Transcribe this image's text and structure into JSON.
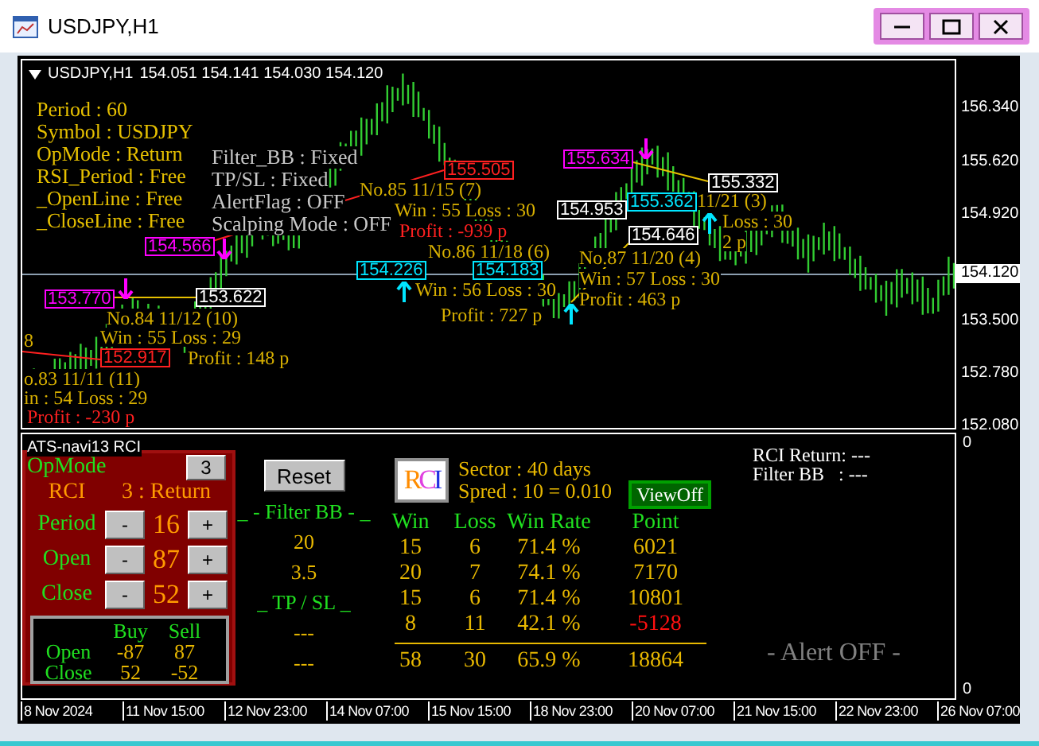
{
  "window": {
    "title": "USDJPY,H1"
  },
  "chart": {
    "header": {
      "symbol": "USDJPY,H1",
      "ohlc": "154.051 154.141 154.030 154.120"
    },
    "info_left": [
      "Period : 60",
      "Symbol : USDJPY",
      "OpMode : Return",
      "RSI_Period : Free",
      "_OpenLine : Free",
      "_CloseLine : Free"
    ],
    "info_right": [
      "Filter_BB : Fixed",
      "TP/SL : Fixed",
      "AlertFlag : OFF",
      "Scalping Mode : OFF"
    ],
    "trade_lines": [
      {
        "kind": "loss"
      },
      {
        "kind": "loss"
      },
      {
        "kind": "win"
      },
      {
        "kind": "win"
      },
      {
        "kind": "win"
      }
    ],
    "trade_texts": [
      {
        "text": "No.84  11/12 (10)",
        "kind": "info"
      },
      {
        "text": "Win : 55   Loss : 29",
        "kind": "info"
      },
      {
        "text": "Profit : 148 p",
        "kind": "info"
      },
      {
        "text": "8",
        "kind": "info"
      },
      {
        "text": "o.83  11/11 (11)",
        "kind": "info"
      },
      {
        "text": "in : 54   Loss : 29",
        "kind": "info"
      },
      {
        "text": "Profit : -230 p",
        "kind": "loss"
      },
      {
        "text": "No.85  11/15 (7)",
        "kind": "info"
      },
      {
        "text": "Win : 55   Loss : 30",
        "kind": "info"
      },
      {
        "text": "Profit : -939 p",
        "kind": "loss"
      },
      {
        "text": "No.86  11/18 (6)",
        "kind": "info"
      },
      {
        "text": "Win : 56   Loss : 30",
        "kind": "info"
      },
      {
        "text": "Profit : 727 p",
        "kind": "info"
      },
      {
        "text": "No.87  11/20 (4)",
        "kind": "info"
      },
      {
        "text": "Win : 57   Loss : 30",
        "kind": "info"
      },
      {
        "text": "Profit : 463 p",
        "kind": "info"
      },
      {
        "text": "11/21 (3)",
        "kind": "info"
      },
      {
        "text": "Loss : 30",
        "kind": "info"
      },
      {
        "text": "2 p",
        "kind": "info"
      }
    ],
    "price_labels": [
      {
        "text": "154.566",
        "kind": "sell"
      },
      {
        "text": "153.770",
        "kind": "sell"
      },
      {
        "text": "153.622",
        "kind": "close"
      },
      {
        "text": "152.917",
        "kind": "loss"
      },
      {
        "text": "155.505",
        "kind": "loss"
      },
      {
        "text": "154.226",
        "kind": "buy"
      },
      {
        "text": "154.183",
        "kind": "buy"
      },
      {
        "text": "154.953",
        "kind": "close"
      },
      {
        "text": "155.634",
        "kind": "sell"
      },
      {
        "text": "155.332",
        "kind": "close"
      },
      {
        "text": "154.646",
        "kind": "close"
      },
      {
        "text": "155.362",
        "kind": "buy"
      }
    ],
    "arrows": [
      {
        "kind": "sell"
      },
      {
        "kind": "sell"
      },
      {
        "kind": "sell"
      },
      {
        "kind": "buy"
      },
      {
        "kind": "buy"
      },
      {
        "kind": "buy"
      }
    ],
    "current_price": "154.120",
    "price_axis": [
      "156.340",
      "155.620",
      "154.920",
      "153.500",
      "152.780",
      "152.080"
    ]
  },
  "indicator": {
    "title": "ATS-navi13  RCI",
    "opmode": {
      "label": "OpMode",
      "value": "3"
    },
    "mode": {
      "label": "RCI",
      "value": "3 : Return"
    },
    "steppers": [
      {
        "label": "Period",
        "minus": "-",
        "value": "16",
        "plus": "+"
      },
      {
        "label": "Open",
        "minus": "-",
        "value": "87",
        "plus": "+"
      },
      {
        "label": "Close",
        "minus": "-",
        "value": "52",
        "plus": "+"
      }
    ],
    "signal_table": {
      "columns": [
        "Buy",
        "Sell"
      ],
      "rows": [
        {
          "label": "Open",
          "buy": "-87",
          "sell": "87"
        },
        {
          "label": "Close",
          "buy": "52",
          "sell": "-52"
        }
      ]
    },
    "reset_button": "Reset",
    "filter_title": "_ - Filter BB - _",
    "filter_values": [
      "20",
      "3.5"
    ],
    "tpsl_title": "_ TP / SL _",
    "tpsl_values": [
      "---",
      "---"
    ],
    "logo": "RCI",
    "sector": "Sector : 40 days",
    "spread": "Spred : 10 = 0.010",
    "view_button": "ViewOff",
    "stats": {
      "columns": [
        "Win",
        "Loss",
        "Win Rate",
        "Point"
      ],
      "rows": [
        {
          "cells": [
            "15",
            "6",
            "71.4 %",
            "6021"
          ],
          "negative": false
        },
        {
          "cells": [
            "20",
            "7",
            "74.1 %",
            "7170"
          ],
          "negative": false
        },
        {
          "cells": [
            "15",
            "6",
            "71.4 %",
            "10801"
          ],
          "negative": false
        },
        {
          "cells": [
            "8",
            "11",
            "42.1 %",
            "-5128"
          ],
          "negative": true
        }
      ],
      "total": [
        "58",
        "30",
        "65.9 %",
        "18864"
      ]
    },
    "status": [
      "RCI Return: ---",
      "Filter BB   : ---"
    ],
    "alert": "- Alert OFF -",
    "scale": [
      "0",
      "0"
    ]
  },
  "time_axis": [
    "8 Nov 2024",
    "11 Nov 15:00",
    "12 Nov 23:00",
    "14 Nov 07:00",
    "15 Nov 15:00",
    "18 Nov 23:00",
    "20 Nov 07:00",
    "21 Nov 15:00",
    "22 Nov 23:00",
    "26 Nov 07:00"
  ]
}
